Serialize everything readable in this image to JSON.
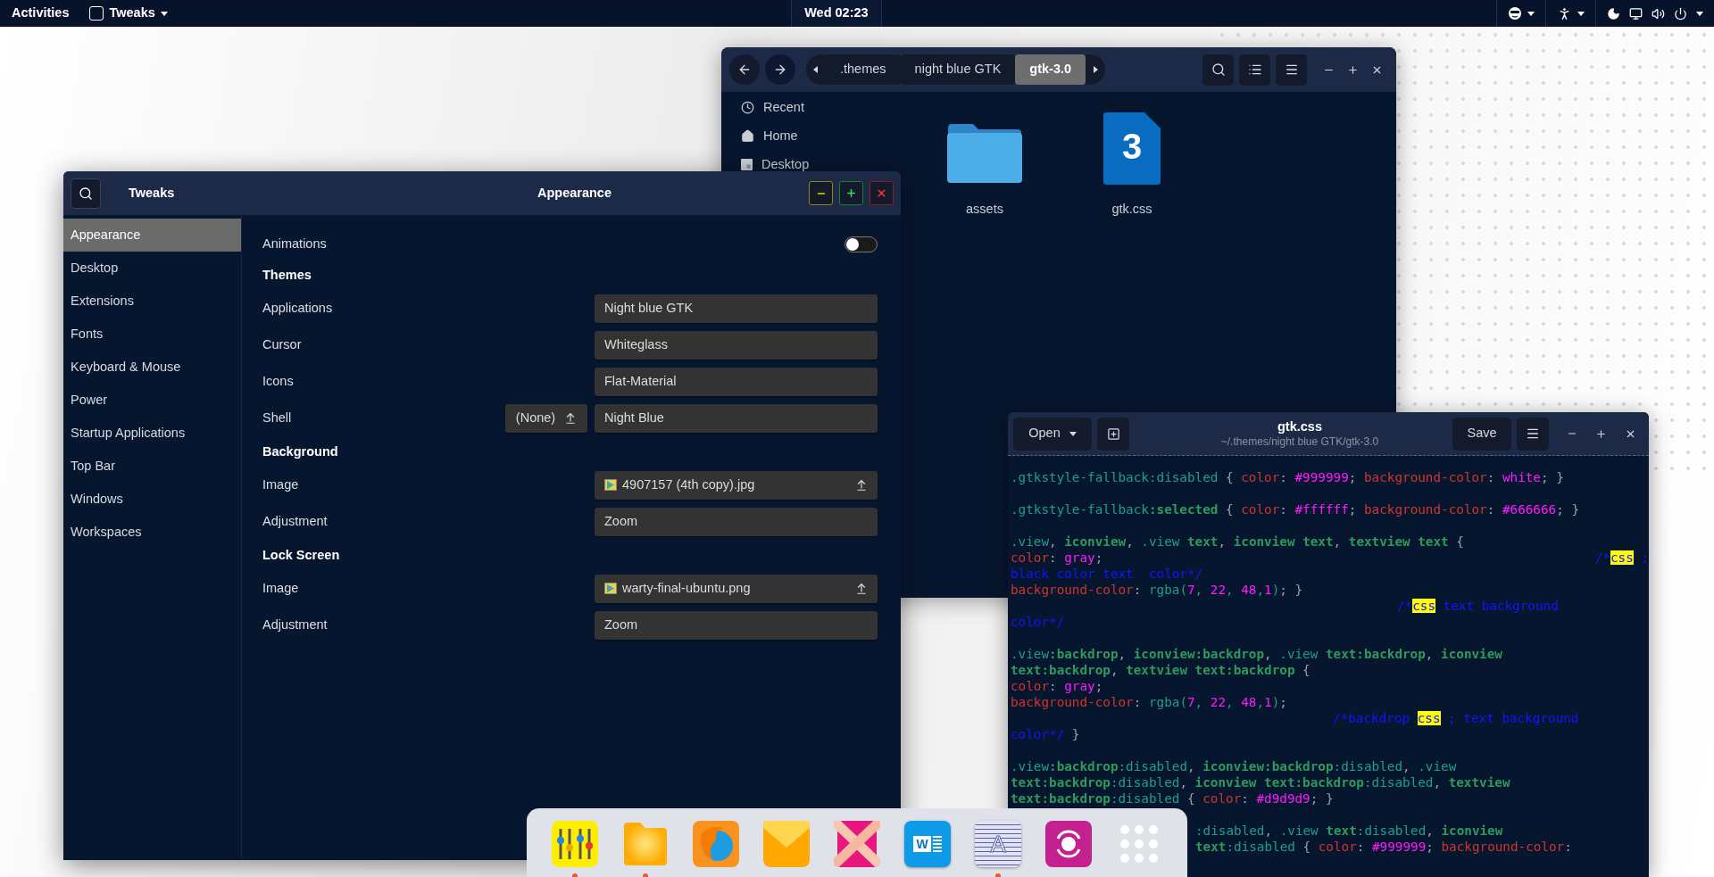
{
  "top_bar": {
    "activities": "Activities",
    "app": "Tweaks",
    "clock": "Wed 02:23"
  },
  "files": {
    "path": [
      {
        "label": ".themes",
        "selected": false
      },
      {
        "label": "night blue GTK",
        "selected": false
      },
      {
        "label": "gtk-3.0",
        "selected": true
      }
    ],
    "sidebar": [
      {
        "label": "Recent",
        "kind": "recent"
      },
      {
        "label": "Home",
        "kind": "home"
      },
      {
        "label": "Desktop",
        "kind": "desktop"
      }
    ],
    "items": [
      {
        "name": "assets",
        "kind": "folder"
      },
      {
        "name": "gtk.css",
        "kind": "css",
        "glyph": "3"
      }
    ]
  },
  "tweaks": {
    "title": "Tweaks",
    "page_title": "Appearance",
    "sidebar": [
      {
        "label": "Appearance",
        "selected": true
      },
      {
        "label": "Desktop",
        "selected": false
      },
      {
        "label": "Extensions",
        "selected": false
      },
      {
        "label": "Fonts",
        "selected": false
      },
      {
        "label": "Keyboard & Mouse",
        "selected": false
      },
      {
        "label": "Power",
        "selected": false
      },
      {
        "label": "Startup Applications",
        "selected": false
      },
      {
        "label": "Top Bar",
        "selected": false
      },
      {
        "label": "Windows",
        "selected": false
      },
      {
        "label": "Workspaces",
        "selected": false
      }
    ],
    "settings": [
      {
        "kind": "switch",
        "label": "Animations",
        "on": false
      },
      {
        "kind": "heading",
        "label": "Themes"
      },
      {
        "kind": "combo",
        "label": "Applications",
        "value": "Night blue GTK"
      },
      {
        "kind": "combo",
        "label": "Cursor",
        "value": "Whiteglass"
      },
      {
        "kind": "combo",
        "label": "Icons",
        "value": "Flat-Material"
      },
      {
        "kind": "combo",
        "label": "Shell",
        "value": "Night Blue",
        "extra": "(None)"
      },
      {
        "kind": "heading",
        "label": "Background"
      },
      {
        "kind": "file",
        "label": "Image",
        "value": "4907157 (4th copy).jpg"
      },
      {
        "kind": "combo",
        "label": "Adjustment",
        "value": "Zoom"
      },
      {
        "kind": "heading",
        "label": "Lock Screen"
      },
      {
        "kind": "file",
        "label": "Image",
        "value": "warty-final-ubuntu.png"
      },
      {
        "kind": "combo",
        "label": "Adjustment",
        "value": "Zoom"
      }
    ]
  },
  "editor": {
    "open": "Open",
    "title": "gtk.css",
    "subtitle": "~/.themes/night blue GTK/gtk-3.0",
    "save": "Save",
    "lines": [
      {
        "kind": "blank"
      },
      {
        "kind": "code",
        "tokens": [
          {
            "text": ".gtkstyle-fallback:disabled",
            "kind": "sel"
          },
          {
            "text": " { ",
            "kind": "p"
          },
          {
            "text": "color",
            "kind": "prop"
          },
          {
            "text": ": ",
            "kind": "p"
          },
          {
            "text": "#999999",
            "kind": "val"
          },
          {
            "text": "; ",
            "kind": "p"
          },
          {
            "text": "background-color",
            "kind": "prop"
          },
          {
            "text": ": ",
            "kind": "p"
          },
          {
            "text": "white",
            "kind": "val"
          },
          {
            "text": "; }",
            "kind": "p"
          }
        ]
      },
      {
        "kind": "blank"
      },
      {
        "kind": "code",
        "tokens": [
          {
            "text": ".gtkstyle-fallback",
            "kind": "sel"
          },
          {
            "text": ":selected",
            "kind": "tag"
          },
          {
            "text": " { ",
            "kind": "p"
          },
          {
            "text": "color",
            "kind": "prop"
          },
          {
            "text": ": ",
            "kind": "p"
          },
          {
            "text": "#ffffff",
            "kind": "val"
          },
          {
            "text": "; ",
            "kind": "p"
          },
          {
            "text": "background-color",
            "kind": "prop"
          },
          {
            "text": ": ",
            "kind": "p"
          },
          {
            "text": "#666666",
            "kind": "val"
          },
          {
            "text": "; }",
            "kind": "p"
          }
        ]
      },
      {
        "kind": "blank"
      },
      {
        "kind": "code",
        "tokens": [
          {
            "text": ".view",
            "kind": "sel"
          },
          {
            "text": ", ",
            "kind": "p"
          },
          {
            "text": "iconview",
            "kind": "tag"
          },
          {
            "text": ", ",
            "kind": "p"
          },
          {
            "text": ".view ",
            "kind": "sel"
          },
          {
            "text": "text",
            "kind": "tag"
          },
          {
            "text": ", ",
            "kind": "p"
          },
          {
            "text": "iconview text",
            "kind": "tag"
          },
          {
            "text": ", ",
            "kind": "p"
          },
          {
            "text": "textview text",
            "kind": "tag"
          },
          {
            "text": " {",
            "kind": "p"
          }
        ]
      },
      {
        "kind": "code",
        "tokens": [
          {
            "text": "color",
            "kind": "prop"
          },
          {
            "text": ": ",
            "kind": "p"
          },
          {
            "text": "gray",
            "kind": "val"
          },
          {
            "text": ";",
            "kind": "p"
          }
        ],
        "aside": [
          {
            "text": "/*",
            "kind": "com"
          },
          {
            "text": "css",
            "kind": "hl"
          },
          {
            "text": " ;",
            "kind": "com"
          }
        ]
      },
      {
        "kind": "code",
        "tokens": [
          {
            "text": "black color text  color*/",
            "kind": "com"
          }
        ]
      },
      {
        "kind": "code",
        "tokens": [
          {
            "text": "background-color",
            "kind": "prop"
          },
          {
            "text": ": ",
            "kind": "p"
          },
          {
            "text": "rgba(",
            "kind": "sel"
          },
          {
            "text": "7",
            "kind": "val"
          },
          {
            "text": ", ",
            "kind": "sel"
          },
          {
            "text": "22",
            "kind": "val"
          },
          {
            "text": ", ",
            "kind": "sel"
          },
          {
            "text": "48",
            "kind": "val"
          },
          {
            "text": ",",
            "kind": "sel"
          },
          {
            "text": "1",
            "kind": "val"
          },
          {
            "text": ")",
            "kind": "sel"
          },
          {
            "text": "; }",
            "kind": "p"
          }
        ]
      },
      {
        "kind": "deep",
        "tokens": [
          {
            "text": "/*",
            "kind": "com"
          },
          {
            "text": "css",
            "kind": "hl"
          },
          {
            "text": " text background",
            "kind": "com"
          }
        ]
      },
      {
        "kind": "code",
        "tokens": [
          {
            "text": "color*/",
            "kind": "com"
          }
        ]
      },
      {
        "kind": "blank"
      },
      {
        "kind": "code",
        "tokens": [
          {
            "text": ".view",
            "kind": "sel"
          },
          {
            "text": ":backdrop",
            "kind": "tag"
          },
          {
            "text": ", ",
            "kind": "p"
          },
          {
            "text": "iconview:backdrop",
            "kind": "tag"
          },
          {
            "text": ", ",
            "kind": "p"
          },
          {
            "text": ".view ",
            "kind": "sel"
          },
          {
            "text": "text:backdrop",
            "kind": "tag"
          },
          {
            "text": ", ",
            "kind": "p"
          },
          {
            "text": "iconview",
            "kind": "tag"
          }
        ]
      },
      {
        "kind": "code",
        "tokens": [
          {
            "text": "text:backdrop",
            "kind": "tag"
          },
          {
            "text": ", ",
            "kind": "p"
          },
          {
            "text": "textview text:backdrop",
            "kind": "tag"
          },
          {
            "text": " {",
            "kind": "p"
          }
        ]
      },
      {
        "kind": "code",
        "tokens": [
          {
            "text": "color",
            "kind": "prop"
          },
          {
            "text": ": ",
            "kind": "p"
          },
          {
            "text": "gray",
            "kind": "val"
          },
          {
            "text": ";",
            "kind": "p"
          }
        ]
      },
      {
        "kind": "code",
        "tokens": [
          {
            "text": "background-color",
            "kind": "prop"
          },
          {
            "text": ": ",
            "kind": "p"
          },
          {
            "text": "rgba(",
            "kind": "sel"
          },
          {
            "text": "7",
            "kind": "val"
          },
          {
            "text": ", ",
            "kind": "sel"
          },
          {
            "text": "22",
            "kind": "val"
          },
          {
            "text": ", ",
            "kind": "sel"
          },
          {
            "text": "48",
            "kind": "val"
          },
          {
            "text": ",",
            "kind": "sel"
          },
          {
            "text": "1",
            "kind": "val"
          },
          {
            "text": ")",
            "kind": "sel"
          },
          {
            "text": ";",
            "kind": "p"
          }
        ]
      },
      {
        "kind": "shallow",
        "tokens": [
          {
            "text": "/*backdrop ",
            "kind": "com"
          },
          {
            "text": "css",
            "kind": "hl"
          },
          {
            "text": " ; text background",
            "kind": "com"
          }
        ]
      },
      {
        "kind": "code",
        "tokens": [
          {
            "text": "color*/",
            "kind": "com"
          },
          {
            "text": " }",
            "kind": "p"
          }
        ]
      },
      {
        "kind": "blank"
      },
      {
        "kind": "code",
        "tokens": [
          {
            "text": ".view",
            "kind": "sel"
          },
          {
            "text": ":backdrop",
            "kind": "tag"
          },
          {
            "text": ":disabled",
            "kind": "sel"
          },
          {
            "text": ", ",
            "kind": "p"
          },
          {
            "text": "iconview:backdrop",
            "kind": "tag"
          },
          {
            "text": ":disabled",
            "kind": "sel"
          },
          {
            "text": ", ",
            "kind": "p"
          },
          {
            "text": ".view",
            "kind": "sel"
          }
        ]
      },
      {
        "kind": "code",
        "tokens": [
          {
            "text": "text:backdrop",
            "kind": "tag"
          },
          {
            "text": ":disabled",
            "kind": "sel"
          },
          {
            "text": ", ",
            "kind": "p"
          },
          {
            "text": "iconview text:backdrop",
            "kind": "tag"
          },
          {
            "text": ":disabled",
            "kind": "sel"
          },
          {
            "text": ", ",
            "kind": "p"
          },
          {
            "text": "textview",
            "kind": "tag"
          }
        ]
      },
      {
        "kind": "code",
        "tokens": [
          {
            "text": "text:backdrop",
            "kind": "tag"
          },
          {
            "text": ":disabled",
            "kind": "sel"
          },
          {
            "text": " { ",
            "kind": "p"
          },
          {
            "text": "color",
            "kind": "prop"
          },
          {
            "text": ": ",
            "kind": "p"
          },
          {
            "text": "#d9d9d9",
            "kind": "val"
          },
          {
            "text": "; }",
            "kind": "p"
          }
        ]
      },
      {
        "kind": "blank"
      },
      {
        "kind": "covered",
        "tokens": [
          {
            "text": ":disabled",
            "kind": "sel"
          },
          {
            "text": ", ",
            "kind": "p"
          },
          {
            "text": ".view ",
            "kind": "sel"
          },
          {
            "text": "text",
            "kind": "tag"
          },
          {
            "text": ":disabled",
            "kind": "sel"
          },
          {
            "text": ", ",
            "kind": "p"
          },
          {
            "text": "iconview",
            "kind": "tag"
          }
        ]
      },
      {
        "kind": "covered",
        "tokens": [
          {
            "text": "text",
            "kind": "tag"
          },
          {
            "text": ":disabled",
            "kind": "sel"
          },
          {
            "text": " { ",
            "kind": "p"
          },
          {
            "text": "color",
            "kind": "prop"
          },
          {
            "text": ": ",
            "kind": "p"
          },
          {
            "text": "#999999",
            "kind": "val"
          },
          {
            "text": "; ",
            "kind": "p"
          },
          {
            "text": "background-color",
            "kind": "prop"
          },
          {
            "text": ":",
            "kind": "p"
          }
        ]
      }
    ]
  },
  "dock": {
    "items": [
      {
        "kind": "mixer",
        "running": true
      },
      {
        "kind": "folder",
        "running": true
      },
      {
        "kind": "browser",
        "running": false
      },
      {
        "kind": "mail",
        "running": false
      },
      {
        "kind": "hands",
        "running": false
      },
      {
        "kind": "word",
        "glyph": "W",
        "running": false
      },
      {
        "kind": "font",
        "glyph": "A",
        "running": true
      },
      {
        "kind": "sync",
        "running": false
      },
      {
        "kind": "grid",
        "running": false
      }
    ]
  }
}
